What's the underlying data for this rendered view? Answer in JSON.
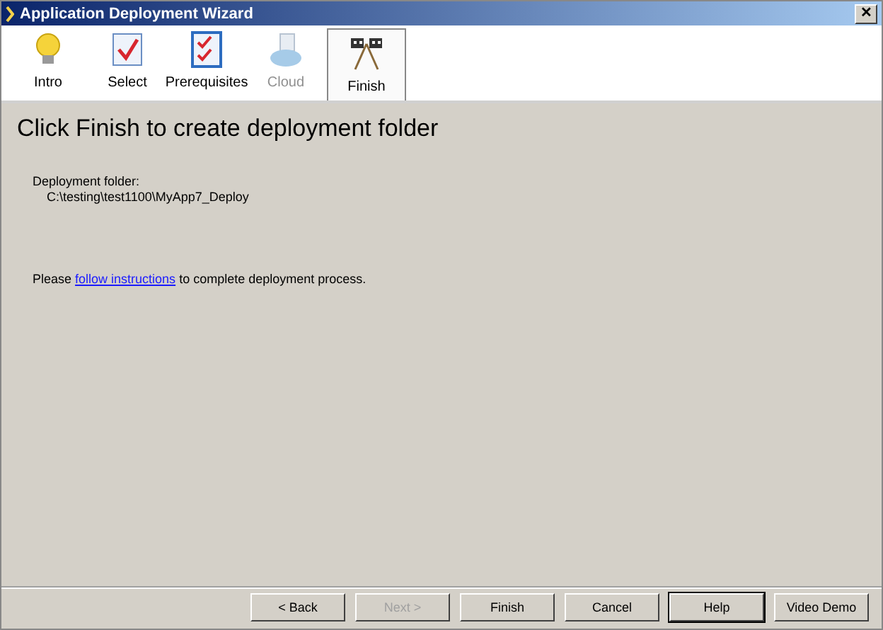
{
  "window": {
    "title": "Application Deployment Wizard",
    "close": "✕"
  },
  "tabs": [
    {
      "label": "Intro",
      "kind": "bulb",
      "selected": false,
      "disabled": false
    },
    {
      "label": "Select",
      "kind": "check",
      "selected": false,
      "disabled": false
    },
    {
      "label": "Prerequisites",
      "kind": "checklist",
      "selected": false,
      "disabled": false
    },
    {
      "label": "Cloud",
      "kind": "cloud",
      "selected": false,
      "disabled": true
    },
    {
      "label": "Finish",
      "kind": "flags",
      "selected": true,
      "disabled": false
    }
  ],
  "heading": "Click Finish to create deployment folder",
  "folder_label": "Deployment folder:",
  "folder_path": "C:\\testing\\test1100\\MyApp7_Deploy",
  "instruction": {
    "before": "Please",
    "link": "follow instructions",
    "after": "to complete deployment process."
  },
  "buttons": [
    {
      "label": "< Back",
      "disabled": false,
      "default": false
    },
    {
      "label": "Next >",
      "disabled": true,
      "default": false
    },
    {
      "label": "Finish",
      "disabled": false,
      "default": false
    },
    {
      "label": "Cancel",
      "disabled": false,
      "default": false
    },
    {
      "label": "Help",
      "disabled": false,
      "default": true
    },
    {
      "label": "Video Demo",
      "disabled": false,
      "default": false
    }
  ]
}
